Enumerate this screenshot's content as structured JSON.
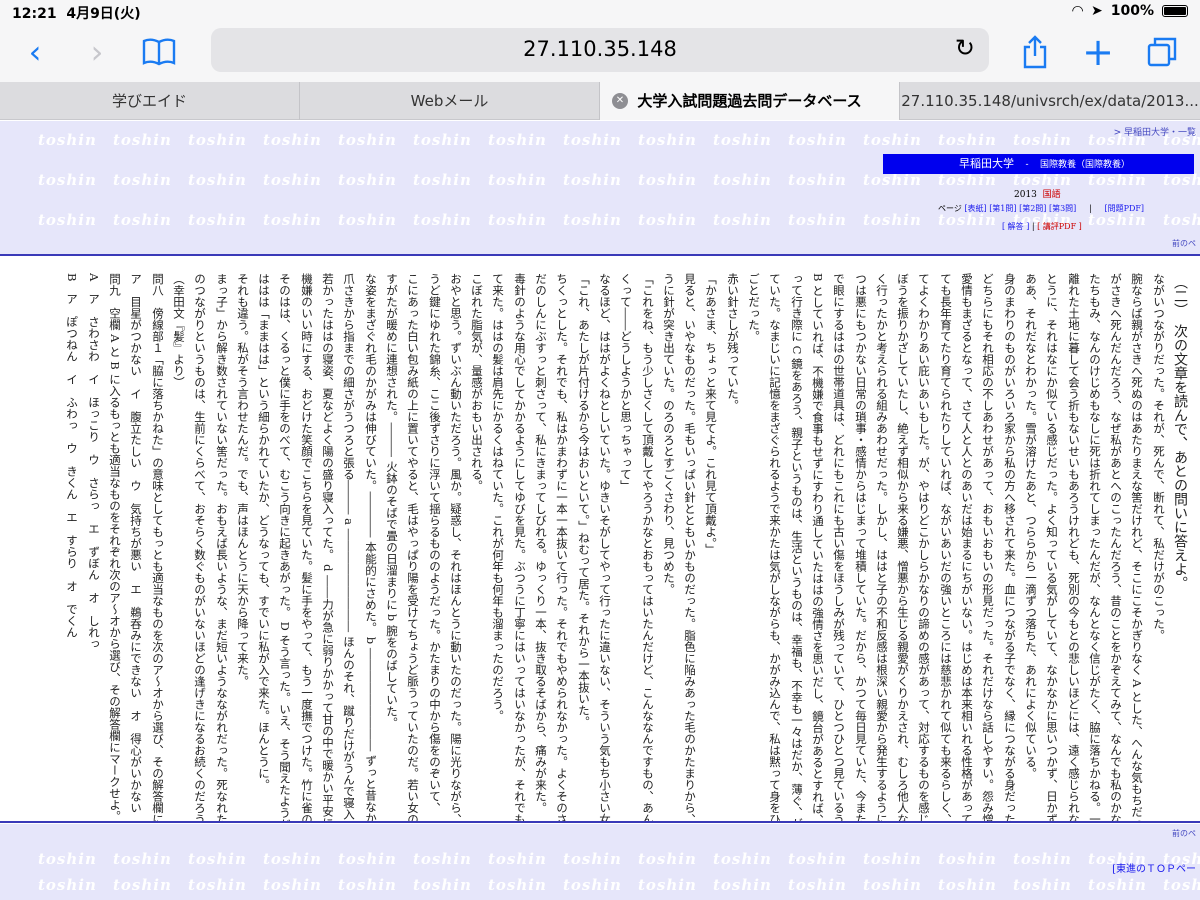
{
  "status": {
    "time": "12:21",
    "date": "4月9日(火)",
    "battery": "100%"
  },
  "browser": {
    "url": "27.110.35.148"
  },
  "tabs": [
    {
      "label": "学びエイド"
    },
    {
      "label": "Webメール"
    },
    {
      "label": "大学入試問題過去問データベース"
    },
    {
      "label": "27.110.35.148/univsrch/ex/data/2013..."
    }
  ],
  "header": {
    "watermark": "toshin",
    "breadcrumb": "> 早稲田大学・一覧",
    "university": "早稲田大学",
    "sep": "-",
    "department": "国際教養（国際教養）",
    "year": "2013",
    "subject": "国語",
    "page_label": "ページ",
    "cover": "[表紙]",
    "p1": "[第1問]",
    "p2": "[第2問]",
    "p3": "[第3問]",
    "pipe": "|",
    "pdf": "[問題PDF]",
    "answer": "[ 解答 ]",
    "commentary": "[ 講評PDF ]",
    "prev": "前のペ"
  },
  "document": {
    "columns": [
      "（二）　次の文章を読んで、あとの問いに答えよ。",
      "ながいつながりだった。それが、死んで、断れて、私だけがのこった。",
      "腕ならば親がさきへ死ぬのはあたりまえな筈だけれど、そこにこそかぎりなく A とした、へんな気もちだった。",
      "がさきへ死んだんだろう、なぜ私があとへのこったんだろう、昔のことをかぞえてみて、なんでも私のかなり後にならなかった",
      "たちもみ、なんのけじめもなしに死は折れてしまったんだが、なんとなく信じがたく、脇に落ちかねる。一つには数年来",
      "離れた土地に暮して会う折もないせいもあろうけれども、死別の今もとの悲しいほどには、遠く感じられない。それはほん",
      "とうに、それはなにか似ている感じだった。よく知っている気がしていて、なかなかに思いつかず、日かずが過ぎてから、",
      "ああ、それだなとわかった。雪が溶けたあと、つららから一滴ずつ落ちた、あれによく似ている。",
      "身のまわりのものがいろいろ家から私の方へ移されて来た。血につながる子でなく、縁につながる身だったから、",
      "どちらにもそれ相応の不しあわせがあって、おもいおもいの形見だった。それだけなら話しやすい。怨み憎みのひまもなく",
      "愛情もまざるとなって、さて人と人とのあいだは始まるにちがいない。はじめは本来相いれる性格があってし、なんにし",
      "ても長年育てたり育てられたりしていれば、ながいあいだの強いところには慈悲かれて似ても来るらしく、したがっ",
      "てよくわかりあい庇いあいもした。が、やはりどこかしらかなりの諦めの感があって、対応するものを感じていた。",
      "ぼうを振りかざしていたし、絶えず相似から来る嫌悪、憎悪から生じる親愛がくりかえされ、むしろ他人ならうま",
      "く行ったかと考えられる組みあわせだった。しかし、ははと子の不和反感は根深い親愛から発生するように見えて、じ",
      "つは悪にもつかない日常の瑣事・感情からはじまって堆積していた。だから、かつて毎日見ていた、今またしばらくぶり",
      "で眼にするははの世帯道具は、どれにもこれにも古い傷をほうしみが残っていて、ひとつひとつ見ているうちに、",
      "B としていれば、不機嫌で食事もせずにすわり通していたははの強情さを思いだし、鏡台があるとすれば、起",
      "って行き際に C 鏡をあろう、親子というものは、生活というものは、幸福も、不幸も一々はだか、薄ぐ、がらくた片付けはいやなし",
      "ていた。なまじいに記憶をまざぐられるようで来かたは気がしながらも、かがみ込んで、私は黙って身をひかえた。",
      "ごとだった。",
      "赤い針さしが残っていた。",
      "「かあさま、ちょっと来て見てよ。これ見て頂戴よ。」",
      "見ると、いやなものだった。毛もいっぱい針とともいかものだった。脂色に陥みあった毛のかたまりから、鋭のよ",
      "うに針が突き出ていた。のろのろとすごくさわり、見つめた。",
      "「これをね、もう少しさくして頂戴してやろうかなとおもってはいたんだけど、こんななんですもの、あんまり気味がわる",
      "くって――どうしようかと思っちゃって」",
      "なるほど、ははがよくねとしいていた。ゆきいそがしてやって行ったに違いない、そういう気もち小さい女の子が私を見た。",
      "「これ、あたしが片付けるから今はおいといて。」ねむって居た。それから一本抜いた。",
      "ちくっとした。それでも、私はかまわずに一本一本抜いて行った。それでもやめられなかった。よくそのさわりが、",
      "だのしんにぶすっと刺さって、私にきまってしびれる。ゆっくり一本、抜き取るそばから、痛みが来た。",
      "毒針のような用心でしてかかるようにしてゆびを見た。ぶつうに丁寧にはいってはいなかったが、それでも",
      "て来た。ははの髪は肩先にかるくはねていた。これが何年も何年も溜まったのだろう。",
      "こぼれた脂気が、量感がおもい出される。",
      "おやと思う。ずいぶん動いただろう。風か。疑惑し、それはほんとうに動いたのだった。陽に光りながら、ちょ",
      "うど鍵にゆれた錦糸、ここ後ずさりに浮いて揺らるもののようだった。かたまりの中から傷をのぞいて、",
      "こにあった白い包み紙の上に置いてやると、毛はやっぱり陽を受けてちょうど脈うっていたのだ。若い女の伸びをする",
      "すがたが暖めに連想された。――― 火鉢のそばで畳の日溜まりに b 腕をのばしていた。",
      "な姿をまざぐれ毛のかがみは伸びていた。―――― 本能的にさめた。 b ――――――――― ずっと昔なかで猫って髪を湯かしていた。 c ",
      "爪さきから指までの細さがうつろと張る――― a ――――――――― ほんのそれ、蹴りだけがうんで寝入って",
      "若かったははの寝姿、夏などよく陽の盛り寝入ってた。 d ――力が急に弱りかかって甘の中で暖かい平安にしずまる。それ",
      "機嫌のいい時にする、おどけた笑顔でこちらを見ていた。髪に手をやって、もう一度撫でつけた。竹に雀の模様のゆかたを着ていたっけ。",
      "そのはは、くるっと僕に手をのべて、むこう向きに起きあがった。 D そう言った。いえ、そう聞えたようだった。いいえ、",
      "ははは「ままはは」という細らかれていたか、どうなっても、すでいに私が入で来た。ほんとうに。",
      "それも違う。私がそう言わせたんだ。でも、声はほんとうに天から降って来た。",
      "まっ子」から解き数されていない筈だった。おもえば長いような、まだ短いようなながれだった。死なれたわの親子",
      "のつながりというものは、生前にくらべて、おそらく数ぐものがいないほどの逢げきになるお続くのだろう。",
      "（幸田文『髪』より）",
      "問八　傍線部１「脇に落ちかねた」の意味としてもっとも適当なものを次のア～オから選び、その解答欄にマークせよ。",
      "ア　目星がつかない　イ　腹立たしい　ウ　気持ちが悪い　エ　鵜呑みにできない　オ　得心がいかない",
      "問九　空欄 A と B に入るもっとも適当なものをそれぞれ次のア～オから選び、その解答欄にマークせよ。",
      "A　ア　さわさわ　イ　ほっこり　ウ　さらっ　エ　ずぼん　オ　しれっ",
      "B　ア　ぽつねん　イ　ふわっ　ウ　きくん　エ　すらり　オ　でくん"
    ]
  },
  "footer": {
    "prev": "前のペ",
    "top": "[東進のＴＯＰペー"
  }
}
